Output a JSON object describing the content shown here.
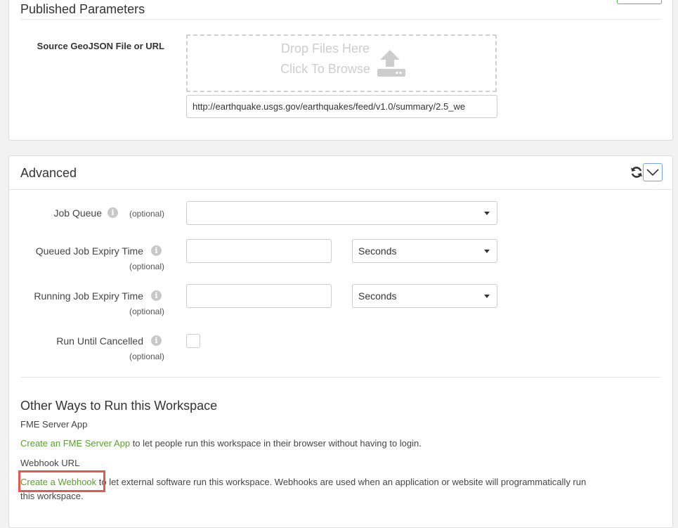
{
  "published": {
    "title": "Published Parameters",
    "source_label": "Source GeoJSON File or URL",
    "drop_line1": "Drop Files Here",
    "drop_line2": "Click To Browse",
    "source_url": "http://earthquake.usgs.gov/earthquakes/feed/v1.0/summary/2.5_we"
  },
  "advanced": {
    "title": "Advanced",
    "job_queue_label": "Job Queue",
    "job_queue_value": "",
    "queued_expiry_label": "Queued Job Expiry Time",
    "queued_expiry_value": "",
    "queued_expiry_unit": "Seconds",
    "running_expiry_label": "Running Job Expiry Time",
    "running_expiry_value": "",
    "running_expiry_unit": "Seconds",
    "run_until_cancelled_label": "Run Until Cancelled",
    "optional": "(optional)"
  },
  "other": {
    "heading": "Other Ways to Run this Workspace",
    "app_heading": "FME Server App",
    "app_link": "Create an FME Server App",
    "app_text": " to let people run this workspace in their browser without having to login.",
    "webhook_heading": "Webhook URL",
    "webhook_link": "Create a Webhook",
    "webhook_text": " to let external software run this workspace. Webhooks are used when an application or website will programmatically run",
    "webhook_text2": "this workspace."
  },
  "colors": {
    "link": "#5a9e2f",
    "highlight": "#e8574b",
    "primary_border": "#7aa7d8"
  }
}
